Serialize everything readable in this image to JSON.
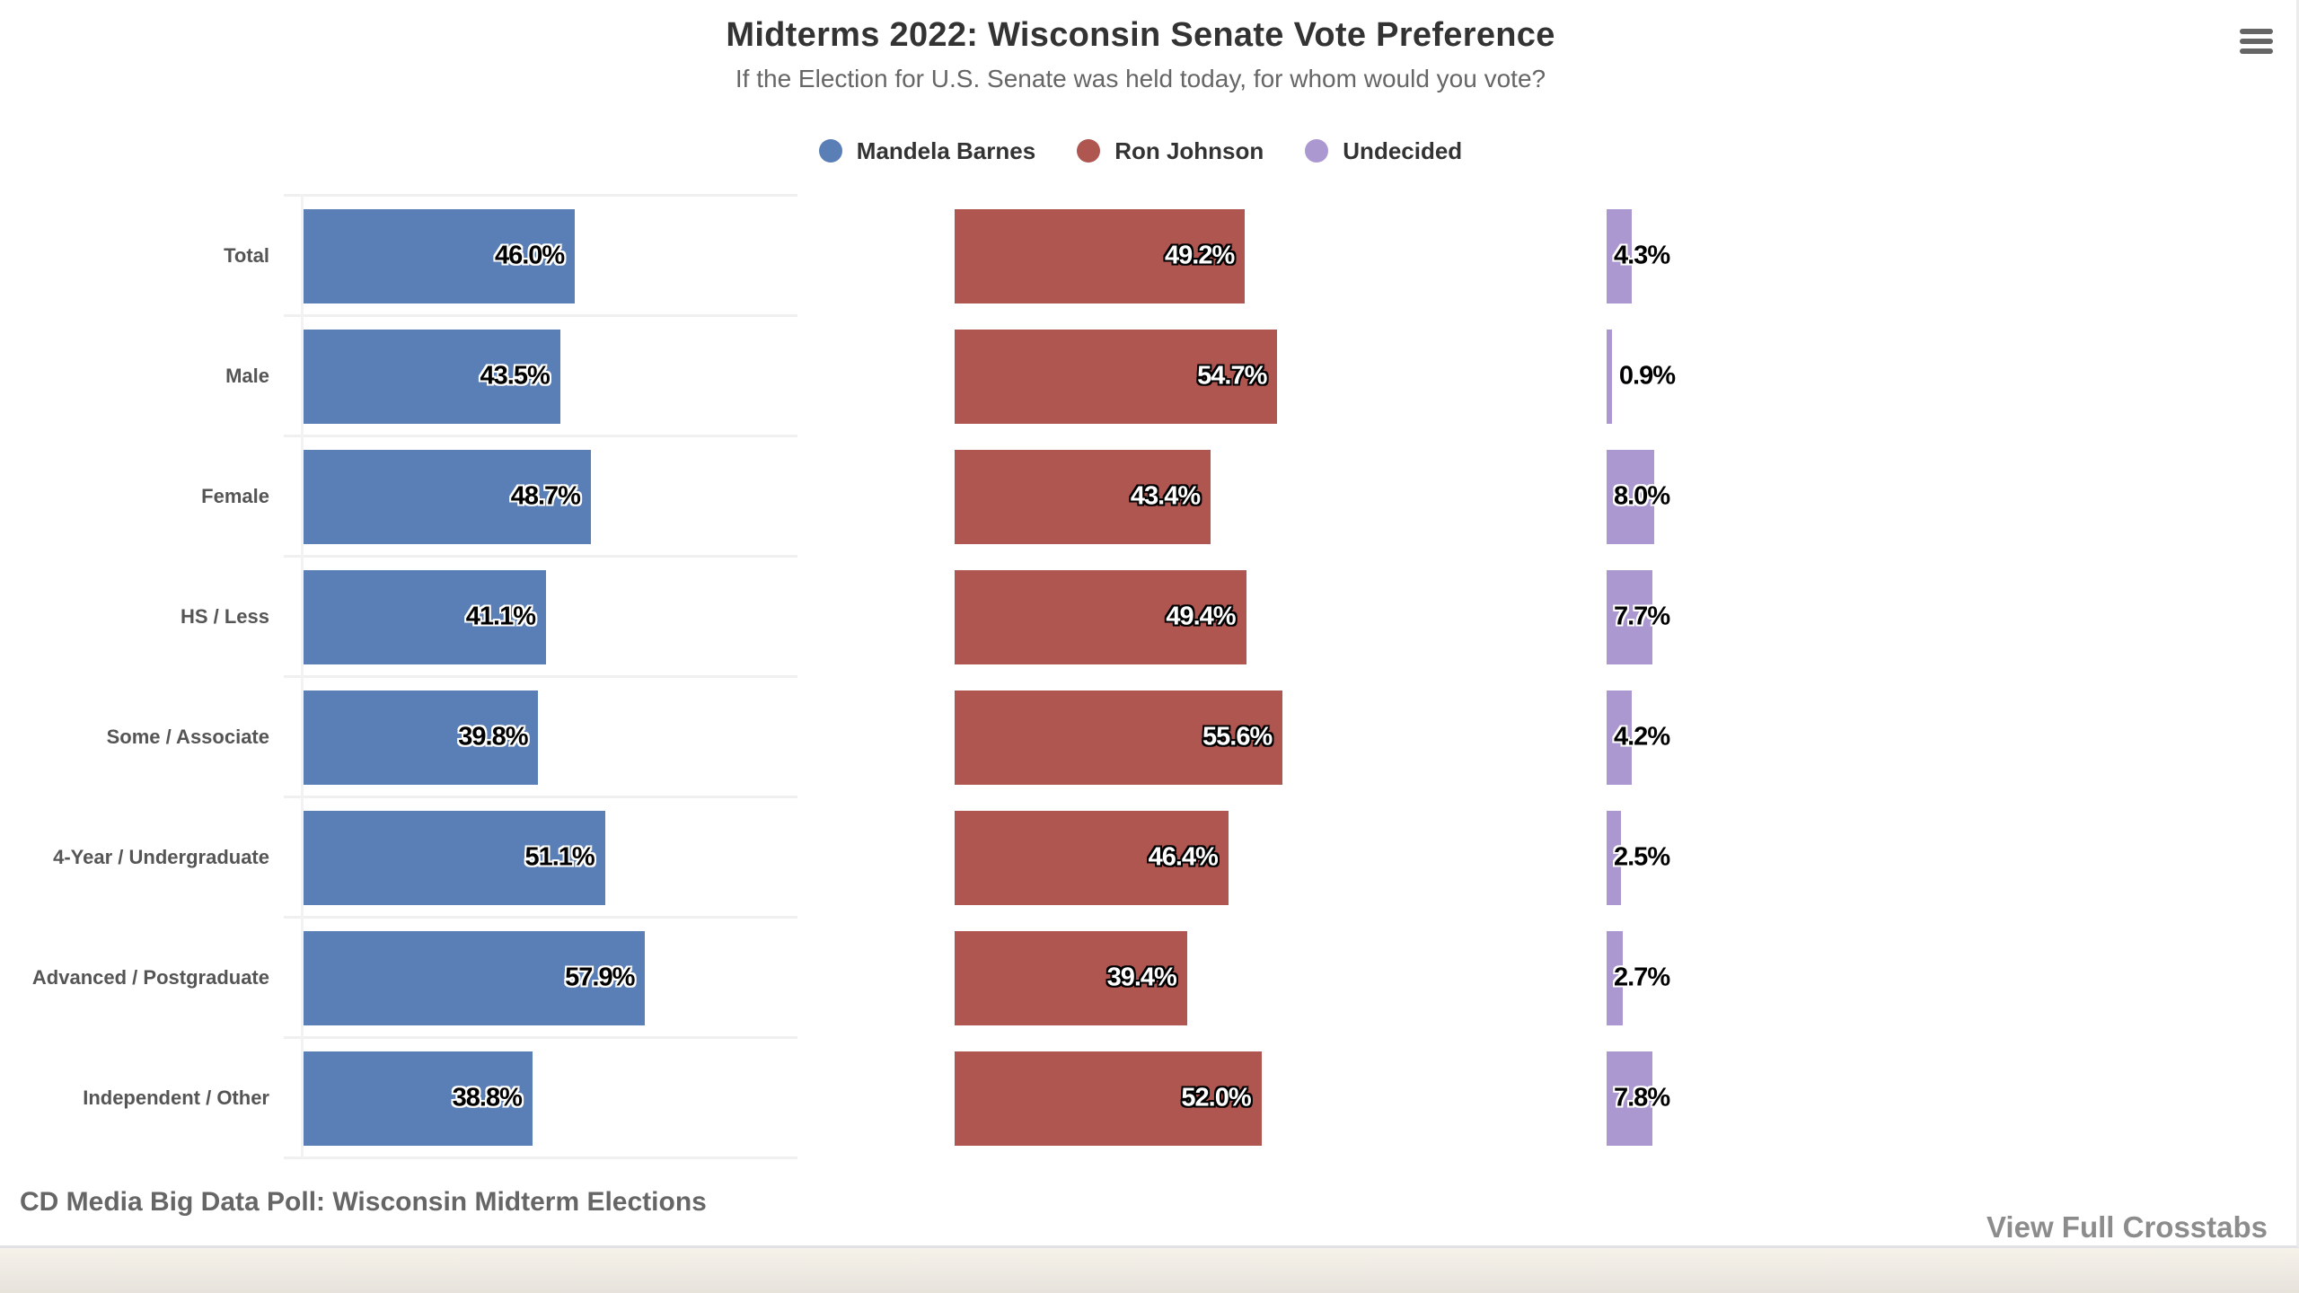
{
  "header": {
    "title": "Midterms 2022: Wisconsin Senate Vote Preference",
    "subtitle": "If the Election for U.S. Senate was held today, for whom would you vote?",
    "menu_icon": "hamburger-menu-icon"
  },
  "footer": {
    "credits": "CD Media Big Data Poll: Wisconsin Midterm Elections",
    "link_label": "View Full Crosstabs"
  },
  "chart_data": {
    "type": "bar",
    "orientation": "horizontal",
    "title": "Midterms 2022: Wisconsin Senate Vote Preference",
    "subtitle": "If the Election for U.S. Senate was held today, for whom would you vote?",
    "xlabel": "",
    "ylabel": "",
    "legend": "top-center",
    "grid": true,
    "value_suffix": "%",
    "categories": [
      "Total",
      "Male",
      "Female",
      "HS / Less",
      "Some / Associate",
      "4-Year / Undergraduate",
      "Advanced / Postgraduate",
      "Independent / Other"
    ],
    "series": [
      {
        "name": "Mandela Barnes",
        "color": "#5a7fb6",
        "values": [
          46.0,
          43.5,
          48.7,
          41.1,
          39.8,
          51.1,
          57.9,
          38.8
        ]
      },
      {
        "name": "Ron Johnson",
        "color": "#b05651",
        "values": [
          49.2,
          54.7,
          43.4,
          49.4,
          55.6,
          46.4,
          39.4,
          52.0
        ]
      },
      {
        "name": "Undecided",
        "color": "#ab98d0",
        "values": [
          4.3,
          0.9,
          8.0,
          7.7,
          4.2,
          2.5,
          2.7,
          7.8
        ]
      }
    ]
  }
}
